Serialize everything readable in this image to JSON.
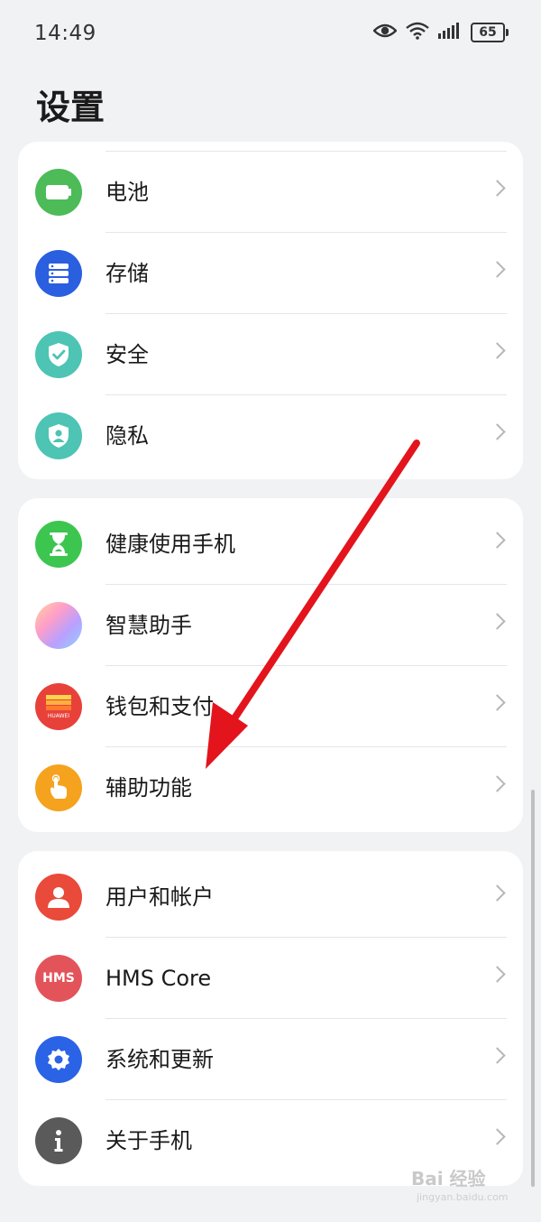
{
  "status_bar": {
    "time": "14:49",
    "battery": "65"
  },
  "page": {
    "title": "设置"
  },
  "groups": [
    {
      "items": [
        {
          "label": "电池",
          "icon": "battery-icon",
          "color": "#4cbb58"
        },
        {
          "label": "存储",
          "icon": "storage-icon",
          "color": "#2a5fe0"
        },
        {
          "label": "安全",
          "icon": "shield-check-icon",
          "color": "#4dc4b4"
        },
        {
          "label": "隐私",
          "icon": "shield-user-icon",
          "color": "#4dc4b4"
        }
      ]
    },
    {
      "items": [
        {
          "label": "健康使用手机",
          "icon": "hourglass-icon",
          "color": "#3cc650"
        },
        {
          "label": "智慧助手",
          "icon": "assistant-icon",
          "color": "#b9a0ff"
        },
        {
          "label": "钱包和支付",
          "icon": "huawei-wallet-icon",
          "color": "#e8413a"
        },
        {
          "label": "辅助功能",
          "icon": "hand-pointer-icon",
          "color": "#f5a21e"
        }
      ]
    },
    {
      "items": [
        {
          "label": "用户和帐户",
          "icon": "user-icon",
          "color": "#e94a3a"
        },
        {
          "label": "HMS Core",
          "icon": "hms-icon",
          "color": "#e3545a"
        },
        {
          "label": "系统和更新",
          "icon": "gear-icon",
          "color": "#2a63e6"
        },
        {
          "label": "关于手机",
          "icon": "info-icon",
          "color": "#5a5a5a"
        }
      ]
    }
  ],
  "wallet_icon_text": "HUAWEI",
  "hms_icon_text": "HMS",
  "watermark": {
    "text": "Bai 经验",
    "sub": "jingyan.baidu.com"
  }
}
